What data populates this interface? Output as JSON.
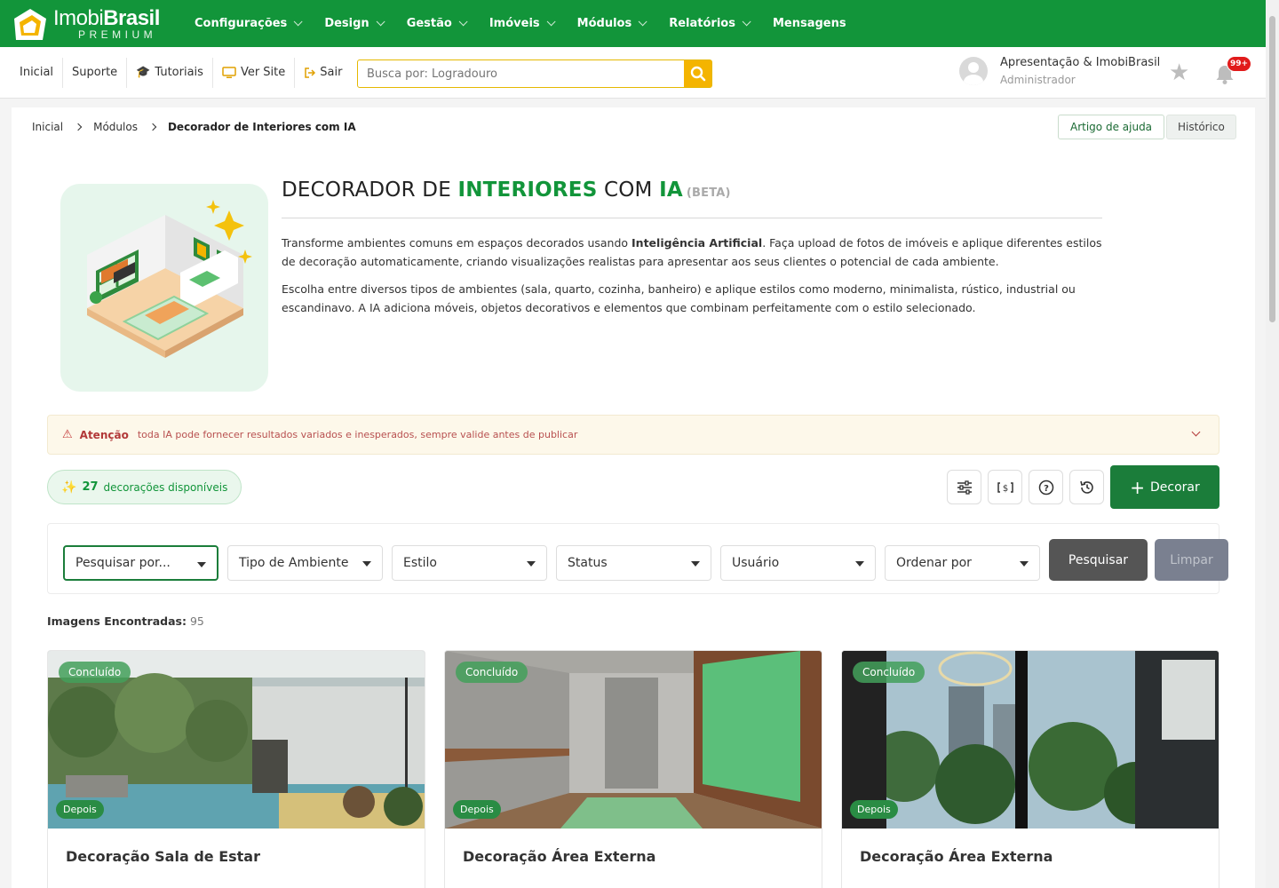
{
  "brand": {
    "name_light": "Imobi",
    "name_bold": "Brasil",
    "tagline": "PREMIUM"
  },
  "nav": [
    {
      "label": "Configurações",
      "dropdown": true
    },
    {
      "label": "Design",
      "dropdown": true
    },
    {
      "label": "Gestão",
      "dropdown": true
    },
    {
      "label": "Imóveis",
      "dropdown": true
    },
    {
      "label": "Módulos",
      "dropdown": true
    },
    {
      "label": "Relatórios",
      "dropdown": true
    },
    {
      "label": "Mensagens",
      "dropdown": false
    }
  ],
  "subbar": {
    "inicial": "Inicial",
    "suporte": "Suporte",
    "tutoriais": "Tutoriais",
    "ver_site": "Ver Site",
    "sair": "Sair",
    "search_placeholder": "Busca por: Logradouro"
  },
  "user": {
    "name": "Apresentação & ImobiBrasil",
    "role": "Administrador",
    "notifications": "99+"
  },
  "breadcrumb": {
    "home": "Inicial",
    "modules": "Módulos",
    "current": "Decorador de Interiores com IA"
  },
  "actions": {
    "help": "Artigo de ajuda",
    "history": "Histórico"
  },
  "hero": {
    "title_a": "DECORADOR DE ",
    "title_b": "INTERIORES",
    "title_c": " COM ",
    "title_d": "IA",
    "beta": "(BETA)",
    "p1_a": "Transforme ambientes comuns em espaços decorados usando ",
    "p1_b": "Inteligência Artificial",
    "p1_c": ". Faça upload de fotos de imóveis e aplique diferentes estilos de decoração automaticamente, criando visualizações realistas para apresentar aos seus clientes o potencial de cada ambiente.",
    "p2": "Escolha entre diversos tipos de ambientes (sala, quarto, cozinha, banheiro) e aplique estilos como moderno, minimalista, rústico, industrial ou escandinavo. A IA adiciona móveis, objetos decorativos e elementos que combinam perfeitamente com o estilo selecionado."
  },
  "alert": {
    "label": "Atenção",
    "text": "toda IA pode fornecer resultados variados e inesperados, sempre valide antes de publicar"
  },
  "credits": {
    "count": "27",
    "label": "decorações disponíveis"
  },
  "decorar_label": "Decorar",
  "filters": {
    "search": "Pesquisar por...",
    "room": "Tipo de Ambiente",
    "style": "Estilo",
    "status": "Status",
    "user": "Usuário",
    "order": "Ordenar por",
    "submit": "Pesquisar",
    "clear": "Limpar"
  },
  "results": {
    "label": "Imagens Encontradas:",
    "count": "95"
  },
  "cards": [
    {
      "status": "Concluído",
      "badge": "Depois",
      "title": "Decoração Sala de Estar"
    },
    {
      "status": "Concluído",
      "badge": "Depois",
      "title": "Decoração Área Externa"
    },
    {
      "status": "Concluído",
      "badge": "Depois",
      "title": "Decoração Área Externa"
    }
  ],
  "colors": {
    "brand_green": "#12953a",
    "button_green": "#1b7d3a",
    "accent_yellow": "#f4b400"
  }
}
